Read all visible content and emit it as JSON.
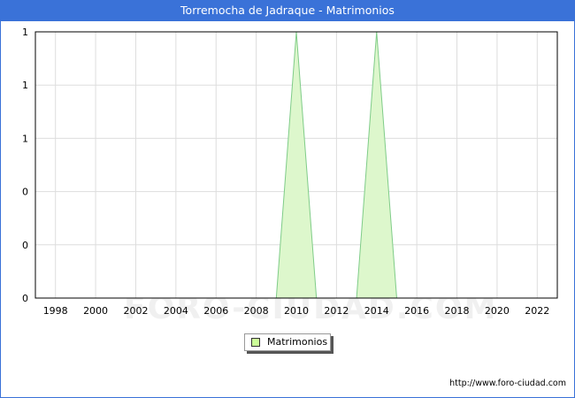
{
  "header": {
    "title": "Torremocha de Jadraque - Matrimonios"
  },
  "footer": {
    "source": "http://www.foro-ciudad.com"
  },
  "watermark": "FORO-CIUDAD.COM",
  "colors": {
    "title_bar": "#3a72d8",
    "fill": "#ddf7cc",
    "line": "#7fcc88",
    "legend_swatch": "#ccff99"
  },
  "chart_data": {
    "type": "area",
    "title": "Torremocha de Jadraque - Matrimonios",
    "xlabel": "",
    "ylabel": "",
    "x": [
      1997,
      1998,
      1999,
      2000,
      2001,
      2002,
      2003,
      2004,
      2005,
      2006,
      2007,
      2008,
      2009,
      2010,
      2011,
      2012,
      2013,
      2014,
      2015,
      2016,
      2017,
      2018,
      2019,
      2020,
      2021,
      2022
    ],
    "series": [
      {
        "name": "Matrimonios",
        "values": [
          0,
          0,
          0,
          0,
          0,
          0,
          0,
          0,
          0,
          0,
          0,
          0,
          0,
          1,
          0,
          0,
          0,
          1,
          0,
          0,
          0,
          0,
          0,
          0,
          0,
          0
        ]
      }
    ],
    "x_ticks": [
      "1998",
      "2000",
      "2002",
      "2004",
      "2006",
      "2008",
      "2010",
      "2012",
      "2014",
      "2016",
      "2018",
      "2020",
      "2022"
    ],
    "y_tick_labels": [
      "0",
      "0",
      "0",
      "1",
      "1",
      "1"
    ],
    "xlim": [
      1997,
      2023
    ],
    "ylim": [
      0,
      1
    ],
    "grid": true,
    "legend_position": "bottom-center"
  }
}
